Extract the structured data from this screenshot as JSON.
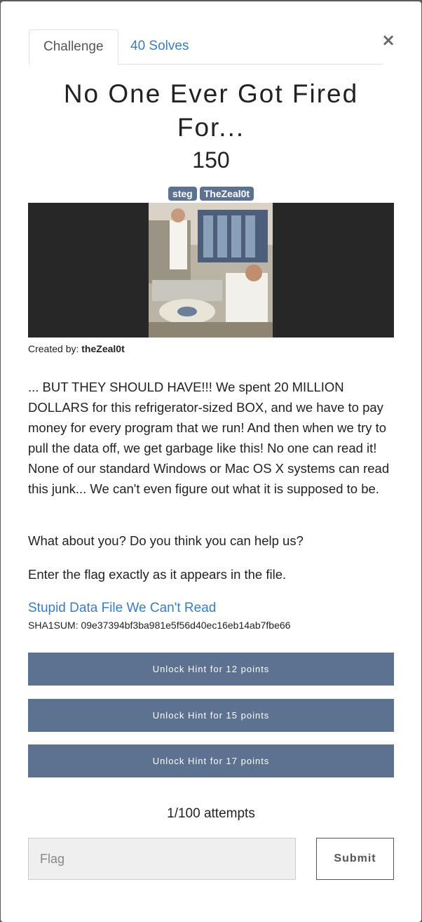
{
  "tabs": {
    "challenge": "Challenge",
    "solves": "40 Solves"
  },
  "close_label": "×",
  "challenge": {
    "title": "No One Ever Got Fired For...",
    "points": "150",
    "tags": [
      "steg",
      "TheZeal0t"
    ],
    "created_by_label": "Created by:",
    "author": "theZeal0t",
    "description": "... BUT THEY SHOULD HAVE!!! We spent 20 MILLION DOLLARS for this refrigerator-sized BOX, and we have to pay money for every program that we run! And then when we try to pull the data off, we get garbage like this! No one can read it! None of our standard Windows or Mac OS X systems can read this junk... We can't even figure out what it is supposed to be.",
    "question": "What about you? Do you think you can help us?",
    "instruction": "Enter the flag exactly as it appears in the file.",
    "file_link": "Stupid Data File We Can't Read",
    "sha": "SHA1SUM: 09e37394bf3ba981e5f56d40ec16eb14ab7fbe66"
  },
  "hints": [
    {
      "label": "Unlock Hint for 12 points"
    },
    {
      "label": "Unlock Hint for 15 points"
    },
    {
      "label": "Unlock Hint for 17 points"
    }
  ],
  "attempts": "1/100 attempts",
  "flag_placeholder": "Flag",
  "submit_label": "Submit",
  "colors": {
    "accent": "#5c7290",
    "link": "#3a7dc0"
  }
}
